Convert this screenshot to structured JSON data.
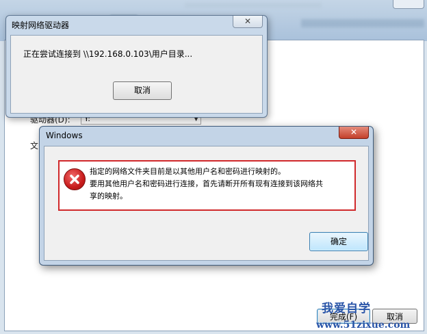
{
  "background_wizard": {
    "drive_label": "驱动器(D):",
    "drive_value": "Y:",
    "folder_label": "文",
    "finish_button": "完成(F)",
    "cancel_button": "取消"
  },
  "progress_dialog": {
    "title": "映射网络驱动器",
    "message": "正在尝试连接到 \\\\192.168.0.103\\用户目录...",
    "cancel_button": "取消",
    "close_glyph": "✕"
  },
  "error_dialog": {
    "title": "Windows",
    "close_glyph": "✕",
    "icon": "error-icon",
    "message_lines": [
      "指定的网络文件夹目前是以其他用户名和密码进行映射的。",
      "要用其他用户名和密码进行连接，首先请断开所有现有连接到该网络共",
      "享的映射。"
    ],
    "ok_button": "确定",
    "highlight_color": "#d0282a"
  },
  "watermark": {
    "line1": "我爱自学",
    "line2": "www.51zixue.com"
  }
}
